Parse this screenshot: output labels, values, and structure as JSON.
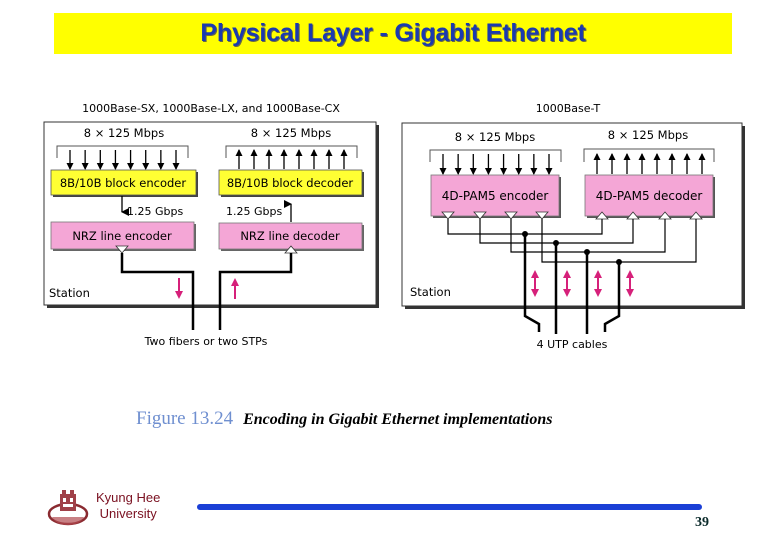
{
  "slide": {
    "title": "Physical Layer - Gigabit Ethernet",
    "page_number": "39",
    "institution": {
      "line1": "Kyung Hee",
      "line2": "University",
      "logo": "university-crest-icon"
    },
    "colors": {
      "title_bg": "#ffff00",
      "title_text": "#1a3ab0",
      "footer_bar": "#1a3fd6",
      "institution_text": "#7a1020"
    }
  },
  "figure": {
    "number": "Figure 13.24",
    "caption": "Encoding in Gigabit Ethernet implementations",
    "left_panel": {
      "heading": "1000Base-SX, 1000Base-LX, and 1000Base-CX",
      "input_rate": "8 × 125 Mbps",
      "output_rate": "8 × 125 Mbps",
      "encoder_block": "8B/10B block encoder",
      "decoder_block": "8B/10B block decoder",
      "link_rate_tx": "1.25 Gbps",
      "link_rate_rx": "1.25 Gbps",
      "line_encoder": "NRZ line encoder",
      "line_decoder": "NRZ line decoder",
      "station_label": "Station",
      "medium_label": "Two fibers or two STPs",
      "parallel_lines": 8
    },
    "right_panel": {
      "heading": "1000Base-T",
      "input_rate": "8 × 125 Mbps",
      "output_rate": "8 × 125 Mbps",
      "encoder_block": "4D-PAM5 encoder",
      "decoder_block": "4D-PAM5 decoder",
      "station_label": "Station",
      "medium_label": "4 UTP cables",
      "parallel_lines": 8,
      "cable_count": 4
    },
    "colors": {
      "block_yellow": "#ffff33",
      "block_pink": "#f4a6d6",
      "arrow_magenta": "#d6207a"
    }
  }
}
